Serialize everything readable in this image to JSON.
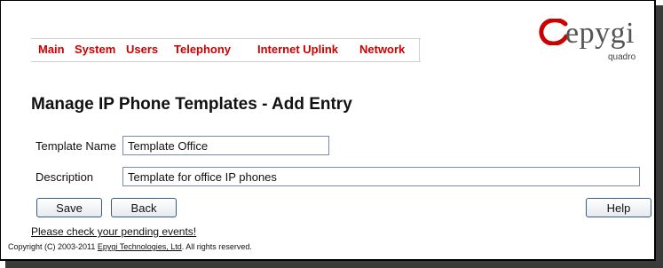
{
  "nav": {
    "items": [
      {
        "label": "Main"
      },
      {
        "label": "System"
      },
      {
        "label": "Users"
      },
      {
        "label": "Telephony"
      },
      {
        "label": "Internet Uplink"
      },
      {
        "label": "Network"
      }
    ]
  },
  "logo": {
    "brand": "epygi",
    "product": "quadro"
  },
  "page": {
    "title": "Manage IP Phone Templates - Add Entry"
  },
  "form": {
    "template_name_label": "Template Name",
    "template_name_value": "Template Office",
    "description_label": "Description",
    "description_value": "Template for office IP phones"
  },
  "buttons": {
    "save": "Save",
    "back": "Back",
    "help": "Help"
  },
  "events_link": "Please check your pending events!",
  "footer": {
    "prefix": "Copyright (C) 2003-2011 ",
    "company": "Epygi Technologies, Ltd",
    "suffix": ". All rights reserved."
  },
  "colors": {
    "menu_text": "#cc0000",
    "logo_red": "#cc0000",
    "logo_gray": "#555555"
  }
}
